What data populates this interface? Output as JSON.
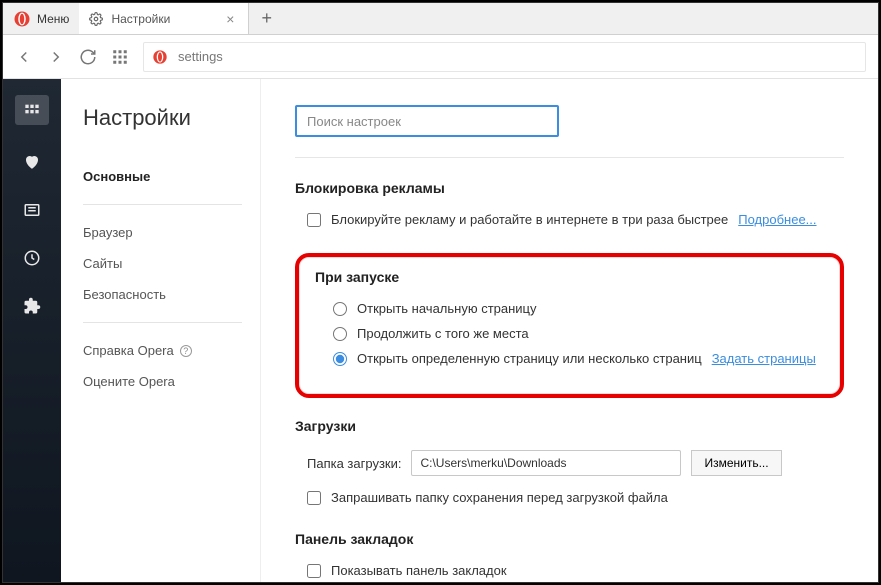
{
  "window": {
    "menu_label": "Меню",
    "tab_title": "Настройки",
    "address": "settings"
  },
  "sidebar": {
    "title": "Настройки",
    "items": [
      {
        "label": "Основные",
        "selected": true
      },
      {
        "label": "Браузер"
      },
      {
        "label": "Сайты"
      },
      {
        "label": "Безопасность"
      }
    ],
    "help_label": "Справка Opera",
    "rate_label": "Оцените Opera"
  },
  "content": {
    "search_placeholder": "Поиск настроек",
    "ads": {
      "title": "Блокировка рекламы",
      "checkbox_label": "Блокируйте рекламу и работайте в интернете в три раза быстрее",
      "learn_more": "Подробнее..."
    },
    "startup": {
      "title": "При запуске",
      "options": [
        "Открыть начальную страницу",
        "Продолжить с того же места",
        "Открыть определенную страницу или несколько страниц"
      ],
      "set_pages_link": "Задать страницы",
      "selected_index": 2
    },
    "downloads": {
      "title": "Загрузки",
      "folder_label": "Папка загрузки:",
      "folder_value": "C:\\Users\\merku\\Downloads",
      "change_button": "Изменить...",
      "ask_checkbox": "Запрашивать папку сохранения перед загрузкой файла"
    },
    "bookmarks_bar": {
      "title": "Панель закладок",
      "checkbox_label": "Показывать панель закладок"
    }
  }
}
